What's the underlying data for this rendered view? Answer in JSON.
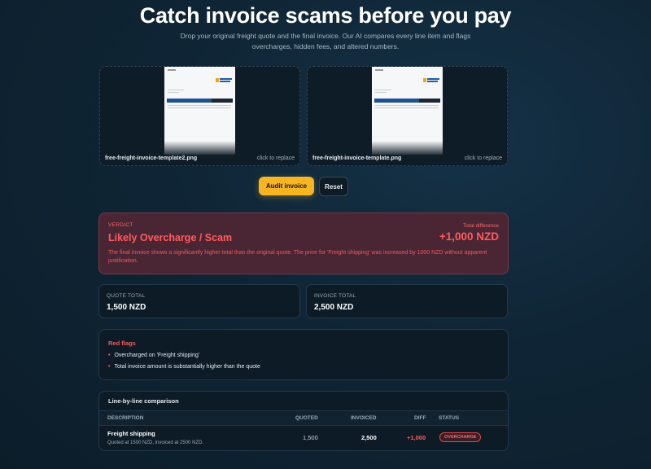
{
  "hero": {
    "title": "Catch invoice scams before you pay",
    "subtitle": "Drop your original freight quote and the final invoice. Our AI compares every line item and flags overcharges, hidden fees, and altered numbers."
  },
  "uploads": [
    {
      "filename": "free-freight-invoice-template2.png",
      "replace_label": "click to replace"
    },
    {
      "filename": "free-freight-invoice-template.png",
      "replace_label": "click to replace"
    }
  ],
  "actions": {
    "audit_label": "Audit invoice",
    "reset_label": "Reset"
  },
  "verdict": {
    "label": "VERDICT",
    "title": "Likely Overcharge / Scam",
    "total_diff_label": "Total difference",
    "total_diff_value": "+1,000 NZD",
    "description": "The final invoice shows a significantly higher total than the original quote. The price for 'Freight shipping' was increased by 1000 NZD without apparent justification.",
    "color": "#ff5c5c"
  },
  "totals": {
    "quote": {
      "label": "QUOTE TOTAL",
      "value": "1,500 NZD"
    },
    "invoice": {
      "label": "INVOICE TOTAL",
      "value": "2,500 NZD"
    }
  },
  "red_flags": {
    "heading": "Red flags",
    "items": [
      "Overcharged on 'Freight shipping'",
      "Total invoice amount is substantially higher than the quote"
    ]
  },
  "comparison": {
    "heading": "Line-by-line comparison",
    "columns": [
      "DESCRIPTION",
      "QUOTED",
      "INVOICED",
      "DIFF",
      "STATUS"
    ],
    "rows": [
      {
        "description": "Freight shipping",
        "note": "Quoted at 1500 NZD, invoiced at 2500 NZD.",
        "quoted": "1,500",
        "invoiced": "2,500",
        "diff": "+1,000",
        "status": "OVERCHARGE"
      }
    ]
  },
  "colors": {
    "accent": "#f7b521",
    "danger": "#ff5c5c",
    "background": "#0f2535"
  }
}
